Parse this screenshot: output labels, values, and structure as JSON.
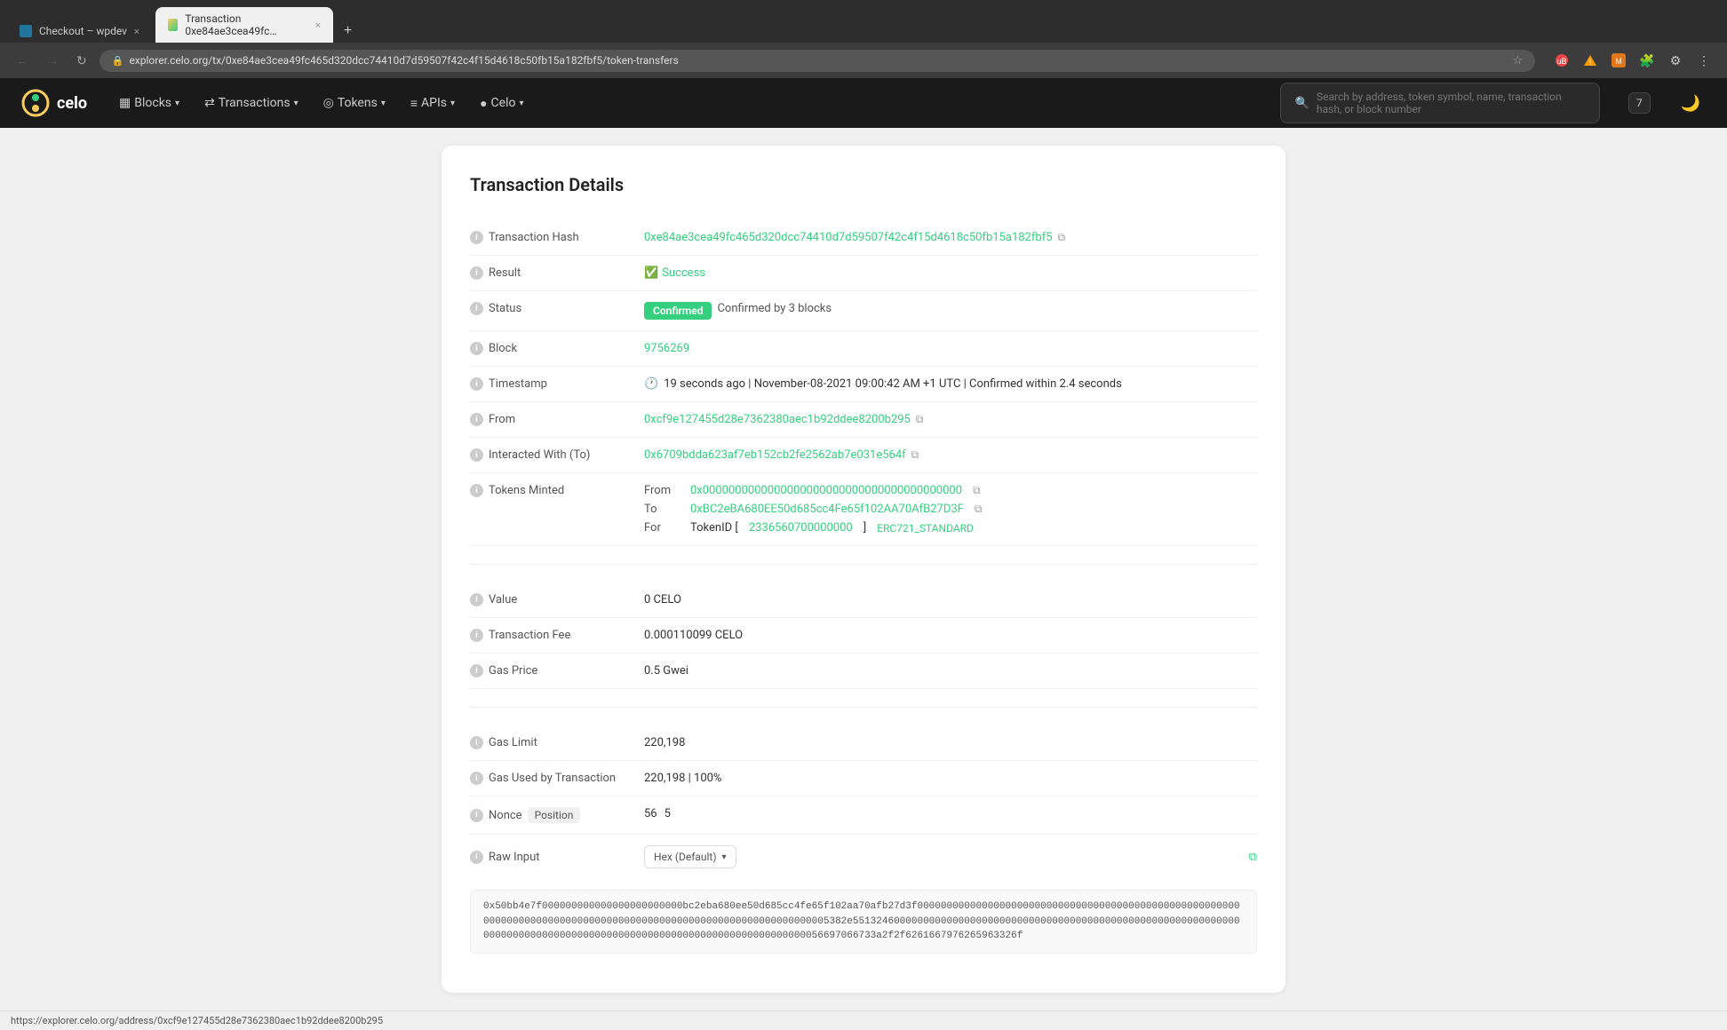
{
  "browser": {
    "tabs": [
      {
        "id": "tab1",
        "favicon_type": "wp",
        "label": "Checkout – wpdev",
        "active": false,
        "close": "×"
      },
      {
        "id": "tab2",
        "favicon_type": "celo",
        "label": "Transaction 0xe84ae3cea49fc…",
        "active": true,
        "close": "×"
      }
    ],
    "new_tab": "+",
    "address": "explorer.celo.org/tx/0xe84ae3cea49fc465d320dcc74410d7d59507f42c4f15d4618c50fb15a182fbf5/token-transfers",
    "nav_back_disabled": true,
    "nav_forward_disabled": true
  },
  "navbar": {
    "logo_text": "celo",
    "links": [
      {
        "label": "Blocks",
        "has_chevron": true
      },
      {
        "label": "Transactions",
        "has_chevron": true
      },
      {
        "label": "Tokens",
        "has_chevron": true
      },
      {
        "label": "APIs",
        "has_chevron": true
      },
      {
        "label": "Celo",
        "has_chevron": true
      }
    ],
    "search_placeholder": "Search by address, token symbol, name, transaction hash, or block number",
    "counter": "7"
  },
  "card": {
    "title": "Transaction Details",
    "rows": [
      {
        "id": "transaction-hash",
        "label": "Transaction Hash",
        "value": "0xe84ae3cea49fc465d320dcc74410d7d59507f42c4f15d4618c50fb15a182fbf5",
        "type": "hash"
      },
      {
        "id": "result",
        "label": "Result",
        "value": "Success",
        "type": "success"
      },
      {
        "id": "status",
        "label": "Status",
        "confirmed_label": "Confirmed",
        "confirmed_blocks": "Confirmed by 3 blocks",
        "type": "status"
      },
      {
        "id": "block",
        "label": "Block",
        "value": "9756269",
        "type": "block"
      },
      {
        "id": "timestamp",
        "label": "Timestamp",
        "value": "19 seconds ago | November-08-2021 09:00:42 AM +1 UTC | Confirmed within 2.4 seconds",
        "type": "timestamp"
      },
      {
        "id": "from",
        "label": "From",
        "value": "0xcf9e127455d28e7362380aec1b92ddee8200b295",
        "type": "address"
      },
      {
        "id": "interacted-with",
        "label": "Interacted With (To)",
        "value": "0x6709bdda623af7eb152cb2fe2562ab7e031e564f",
        "type": "address"
      },
      {
        "id": "tokens-minted",
        "label": "Tokens Minted",
        "type": "tokens",
        "tokens": {
          "from": "0x0000000000000000000000000000000000000000",
          "to": "0xBC2eBA680EE50d685cc4Fe65f102AA70AfB27D3F",
          "for_token_id": "2336560700000000",
          "for_type": "ERC721_STANDARD"
        }
      }
    ],
    "value_row": {
      "label": "Value",
      "value": "0 CELO"
    },
    "fee_row": {
      "label": "Transaction Fee",
      "value": "0.000110099 CELO"
    },
    "gas_price_row": {
      "label": "Gas Price",
      "value": "0.5 Gwei"
    },
    "gas_limit_row": {
      "label": "Gas Limit",
      "value": "220,198"
    },
    "gas_used_row": {
      "label": "Gas Used by Transaction",
      "value": "220,198 | 100%"
    },
    "nonce_row": {
      "label": "Nonce",
      "position_label": "Position",
      "nonce_value": "56",
      "position_value": "5"
    },
    "raw_input_row": {
      "label": "Raw Input",
      "format_label": "Hex (Default)",
      "data": "0x50bb4e7f000000000000000000000000bc2eba680ee50d685cc4fe65f102aa70afb27d3f000000000000000000000000000000000000000000000000000000000000000000000000000000000000000000000000000000000000000005382e5513246000000000000000000000000000000000000000000000000000000000000000000000000000000000000000000000000000000000000000000056697066733a2f2f6261667976265963326f"
    }
  },
  "status_bar": {
    "url": "https://explorer.celo.org/address/0xcf9e127455d28e7362380aec1b92ddee8200b295"
  }
}
